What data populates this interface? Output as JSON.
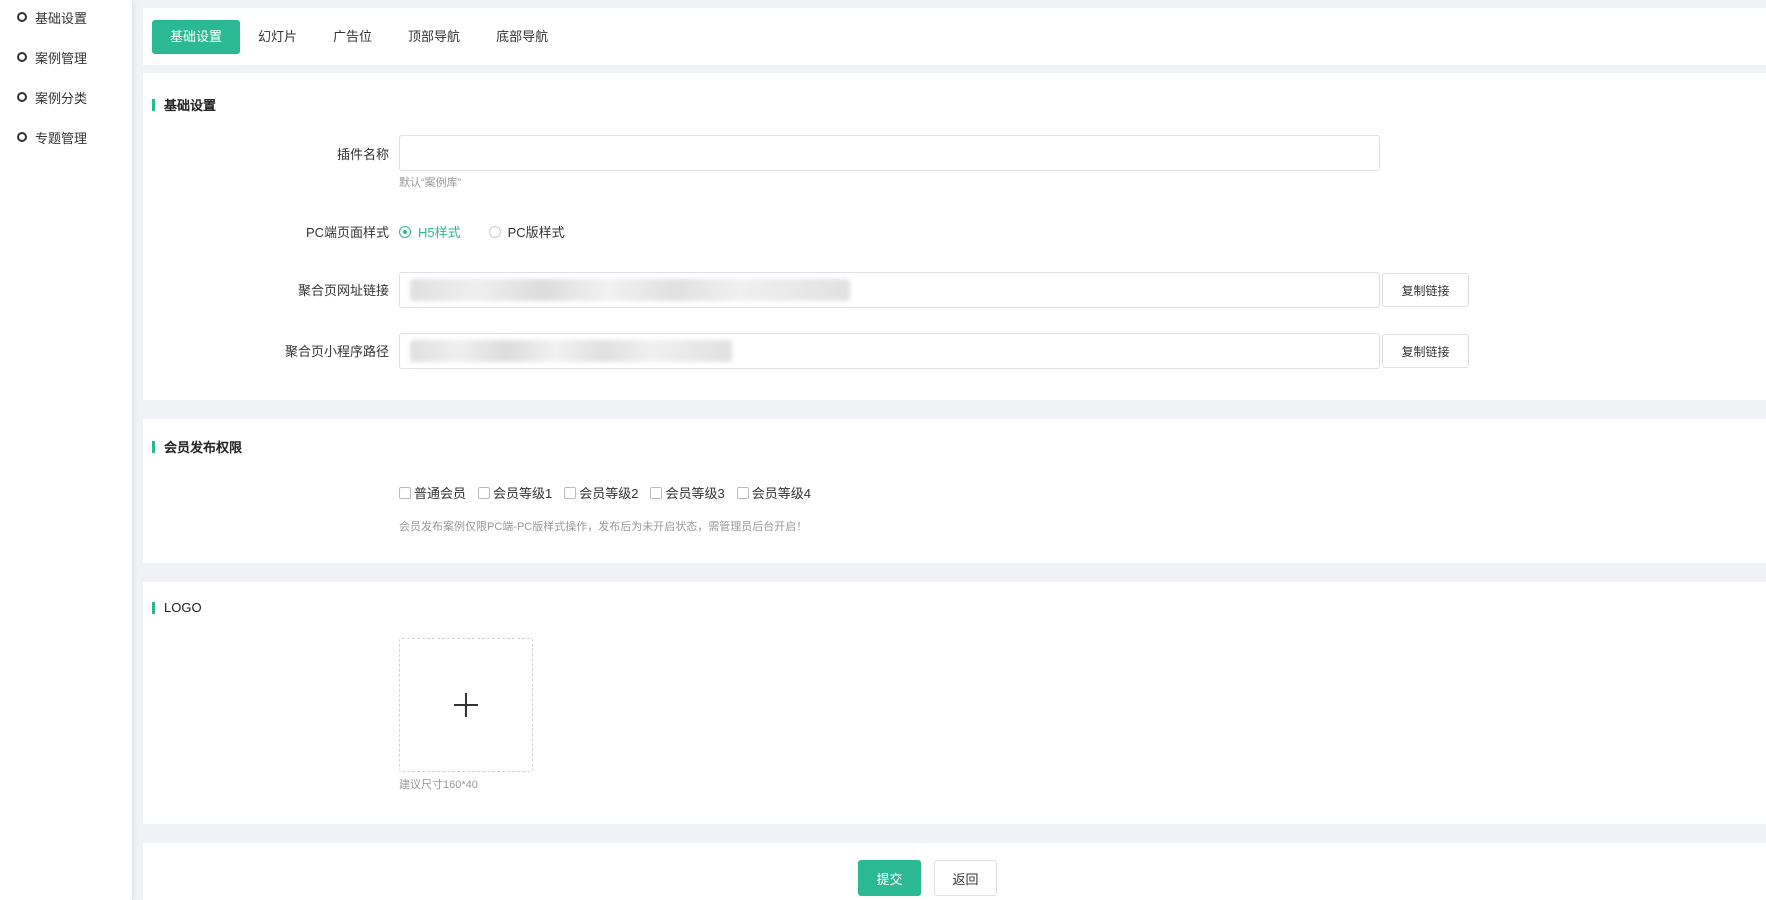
{
  "sidebar": {
    "items": [
      {
        "label": "基础设置"
      },
      {
        "label": "案例管理"
      },
      {
        "label": "案例分类"
      },
      {
        "label": "专题管理"
      }
    ]
  },
  "tabs": [
    {
      "label": "基础设置",
      "active": true
    },
    {
      "label": "幻灯片"
    },
    {
      "label": "广告位"
    },
    {
      "label": "顶部导航"
    },
    {
      "label": "底部导航"
    }
  ],
  "basic": {
    "title": "基础设置",
    "plugin_name_label": "插件名称",
    "plugin_name_value": "",
    "plugin_name_hint": "默认“案例库”",
    "pc_style_label": "PC端页面样式",
    "pc_style_options": [
      "H5样式",
      "PC版样式"
    ],
    "pc_style_selected": "H5样式",
    "agg_url_label": "聚合页网址链接",
    "agg_path_label": "聚合页小程序路径",
    "copy_label": "复制链接"
  },
  "member": {
    "title": "会员发布权限",
    "options": [
      "普通会员",
      "会员等级1",
      "会员等级2",
      "会员等级3",
      "会员等级4"
    ],
    "note": "会员发布案例仅限PC端-PC版样式操作，发布后为未开启状态，需管理员后台开启！"
  },
  "logo": {
    "title": "LOGO",
    "hint": "建议尺寸160*40"
  },
  "actions": {
    "submit": "提交",
    "back": "返回"
  },
  "colors": {
    "accent": "#2bb994"
  }
}
